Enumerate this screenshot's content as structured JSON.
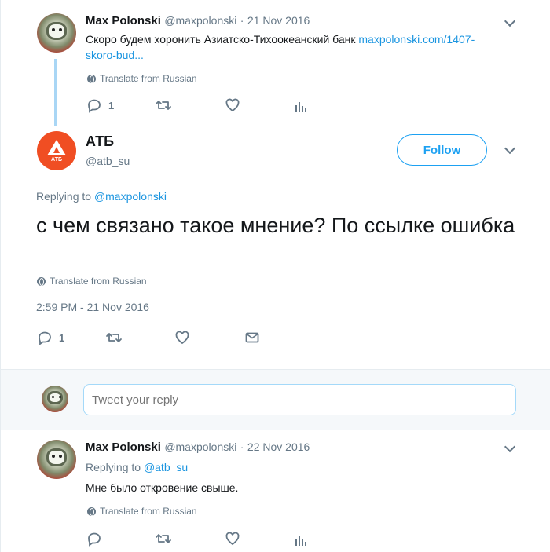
{
  "parent_tweet": {
    "name": "Max Polonski",
    "handle": "@maxpolonski",
    "date": "21 Nov 2016",
    "text_prefix": "Скоро будем хоронить Азиатско-Тихоокеанский банк ",
    "link_line1": "maxpolonski.com/1407-",
    "link_line2": "skoro-bud...",
    "translate": "Translate from Russian",
    "reply_count": "1"
  },
  "main_tweet": {
    "name": "АТБ",
    "handle": "@atb_su",
    "avatar_label": "АТБ",
    "follow_label": "Follow",
    "replying_prefix": "Replying to ",
    "replying_handle": "@maxpolonski",
    "text": "с чем связано такое мнение? По ссылке ошибка",
    "translate": "Translate from Russian",
    "timestamp": "2:59 PM - 21 Nov 2016",
    "reply_count": "1"
  },
  "reply_box": {
    "placeholder": "Tweet your reply"
  },
  "reply_tweet": {
    "name": "Max Polonski",
    "handle": "@maxpolonski",
    "date": "22 Nov 2016",
    "replying_prefix": "Replying to ",
    "replying_handle": "@atb_su",
    "text": "Мне было откровение свыше.",
    "translate": "Translate from Russian"
  },
  "colors": {
    "accent": "#1da1f2",
    "brand_atb": "#f04e23",
    "muted": "#657786"
  }
}
